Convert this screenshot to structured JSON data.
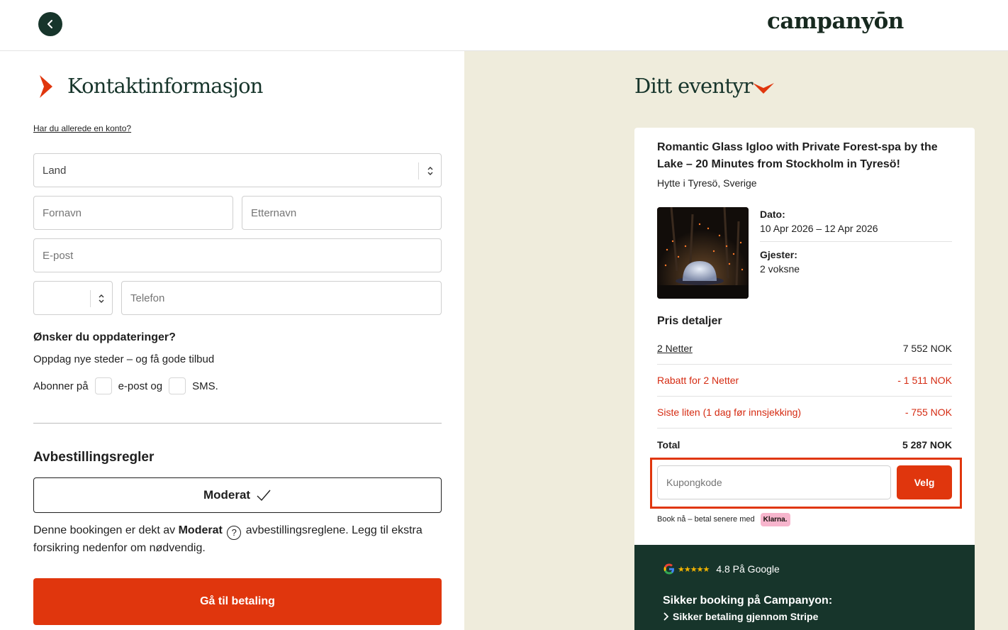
{
  "header": {
    "logo_text": "campanyōn",
    "back_icon": "chevron-left-icon"
  },
  "contact": {
    "title": "Kontaktinformasjon",
    "account_link": "Har du allerede en konto?",
    "fields": {
      "land_placeholder": "Land",
      "fornavn_placeholder": "Fornavn",
      "etternavn_placeholder": "Etternavn",
      "email_placeholder": "E-post",
      "country_code_value": "",
      "telefon_placeholder": "Telefon"
    },
    "updates_title": "Ønsker du oppdateringer?",
    "updates_sub": "Oppdag nye steder – og få gode tilbud",
    "subscribe_prefix": "Abonner på",
    "subscribe_email": "e-post og",
    "subscribe_sms": "SMS."
  },
  "cancellation": {
    "title": "Avbestillingsregler",
    "option_label": "Moderat",
    "desc_prefix": "Denne bookingen er dekt av",
    "desc_policy": "Moderat",
    "desc_suffix": "avbestillingsreglene. Legg til ekstra forsikring nedenfor om nødvendig.",
    "help_symbol": "?"
  },
  "pay_button": "Gå til betaling",
  "adventure": {
    "title": "Ditt eventyr",
    "listing_title": "Romantic Glass Igloo with Private Forest-spa by the Lake – 20 Minutes from Stockholm in Tyresö!",
    "location": "Hytte i Tyresö, Sverige",
    "dato_label": "Dato:",
    "dato_value": "10 Apr 2026 – 12 Apr 2026",
    "gjester_label": "Gjester:",
    "gjester_value": "2 voksne",
    "price_title": "Pris detaljer",
    "price_rows": [
      {
        "label": "2 Netter",
        "value": "7 552 NOK"
      },
      {
        "label": "Rabatt for 2 Netter",
        "value": "- 1 511 NOK"
      },
      {
        "label": "Siste liten (1 dag før innsjekking)",
        "value": "- 755 NOK"
      },
      {
        "label": "Total",
        "value": "5 287 NOK"
      }
    ],
    "coupon_placeholder": "Kupongkode",
    "coupon_button": "Velg",
    "klarna_text": "Book nå – betal senere med",
    "klarna_badge": "Klarna."
  },
  "trust": {
    "rating_stars": "★★★★★",
    "rating_text": "4.8 På Google",
    "secure_title": "Sikker booking på Campanyon:",
    "secure_item": "Sikker betaling gjennom Stripe"
  },
  "colors": {
    "accent": "#e0360d",
    "dark_green": "#17352b",
    "beige": "#efecdc"
  }
}
